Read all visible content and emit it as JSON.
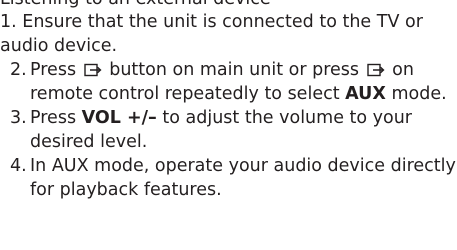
{
  "heading_partial": "Listening to an external device",
  "intro": "1. Ensure that the unit is connected to the TV or audio device.",
  "steps": [
    {
      "num": "2.",
      "text_before": "Press",
      "icon_main": "source-button-icon",
      "text_middle": "button on main unit or press",
      "icon_remote": "source-button-icon",
      "text_after_line": "on remote control repeatedly to select",
      "bold": "AUX",
      "text_end": "mode."
    },
    {
      "num": "3.",
      "text_before": "Press",
      "bold": "VOL +/–",
      "text_after": "to adjust the volume to your desired level."
    },
    {
      "num": "4.",
      "text": "In AUX mode, operate your audio device directly for playback features."
    }
  ]
}
